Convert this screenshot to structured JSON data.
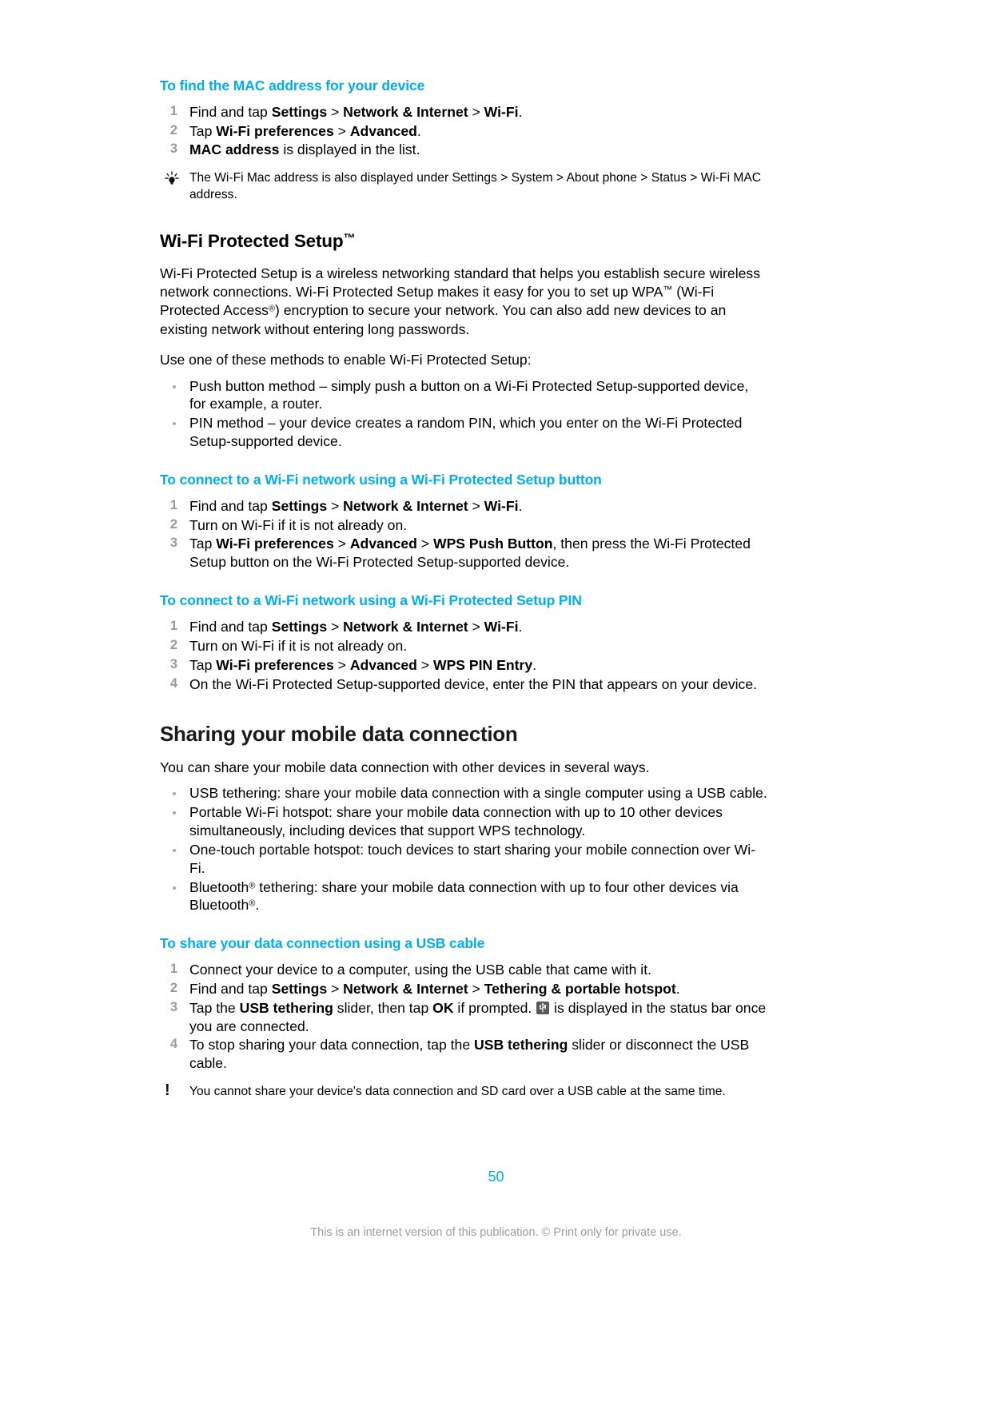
{
  "document": {
    "page_number": "50",
    "footer_note": "This is an internet version of this publication. © Print only for private use.",
    "accent_color": "#00AEEF",
    "step_number_color": "#9a9a9a"
  },
  "sections": {
    "mac_address": {
      "heading": "To find the MAC address for your device",
      "steps": [
        {
          "prefix": "Find and tap ",
          "b1": "Settings",
          "sep1": " > ",
          "b2": "Network & Internet",
          "sep2": " > ",
          "b3": "Wi-Fi",
          "suffix": "."
        },
        {
          "prefix": "Tap ",
          "b1": "Wi-Fi preferences",
          "sep1": " > ",
          "b2": "Advanced",
          "suffix": "."
        },
        {
          "b1": "MAC address",
          "suffix": " is displayed in the list."
        }
      ],
      "tip": {
        "icon": "lightbulb-icon",
        "text": "The Wi-Fi Mac address is also displayed under Settings > System > About phone > Status > Wi-Fi MAC address."
      }
    },
    "wps": {
      "heading": "Wi-Fi Protected Setup",
      "heading_tm": "™",
      "intro_p1_a": "Wi-Fi Protected Setup is a wireless networking standard that helps you establish secure wireless network connections. Wi-Fi Protected Setup makes it easy for you to set up WPA",
      "intro_p1_tm": "™",
      "intro_p1_b": " (Wi-Fi Protected Access",
      "intro_p1_reg": "®",
      "intro_p1_c": ") encryption to secure your network. You can also add new devices to an existing network without entering long passwords.",
      "intro_p2": "Use one of these methods to enable Wi-Fi Protected Setup:",
      "methods": [
        "Push button method – simply push a button on a Wi-Fi Protected Setup-supported device, for example, a router.",
        "PIN method – your device creates a random PIN, which you enter on the Wi-Fi Protected Setup-supported device."
      ],
      "button_proc": {
        "heading": "To connect to a Wi-Fi network using a Wi-Fi Protected Setup button",
        "steps": [
          {
            "prefix": "Find and tap ",
            "b1": "Settings",
            "sep1": " > ",
            "b2": "Network & Internet",
            "sep2": " > ",
            "b3": "Wi-Fi",
            "suffix": "."
          },
          {
            "prefix": "Turn on Wi-Fi if it is not already on."
          },
          {
            "prefix": "Tap ",
            "b1": "Wi-Fi preferences",
            "sep1": " > ",
            "b2": "Advanced",
            "sep2": " > ",
            "b3": "WPS Push Button",
            "suffix": ", then press the Wi-Fi Protected Setup button on the Wi-Fi Protected Setup-supported device."
          }
        ]
      },
      "pin_proc": {
        "heading": "To connect to a Wi-Fi network using a Wi-Fi Protected Setup PIN",
        "steps": [
          {
            "prefix": "Find and tap ",
            "b1": "Settings",
            "sep1": " > ",
            "b2": "Network & Internet",
            "sep2": " > ",
            "b3": "Wi-Fi",
            "suffix": "."
          },
          {
            "prefix": "Turn on Wi-Fi if it is not already on."
          },
          {
            "prefix": "Tap ",
            "b1": "Wi-Fi preferences",
            "sep1": " > ",
            "b2": "Advanced",
            "sep2": " > ",
            "b3": "WPS PIN Entry",
            "suffix": "."
          },
          {
            "prefix": "On the Wi-Fi Protected Setup-supported device, enter the PIN that appears on your device."
          }
        ]
      }
    },
    "sharing": {
      "heading": "Sharing your mobile data connection",
      "intro": "You can share your mobile data connection with other devices in several ways.",
      "methods": [
        {
          "text_a": "USB tethering: share your mobile data connection with a single computer using a USB cable."
        },
        {
          "text_a": "Portable Wi-Fi hotspot: share your mobile data connection with up to 10 other devices simultaneously, including devices that support WPS technology."
        },
        {
          "text_a": "One-touch portable hotspot: touch devices to start sharing your mobile connection over Wi-Fi."
        },
        {
          "text_a": "Bluetooth",
          "reg_a": "®",
          "text_b": " tethering: share your mobile data connection with up to four other devices via Bluetooth",
          "reg_b": "®",
          "text_c": "."
        }
      ],
      "usb_proc": {
        "heading": "To share your data connection using a USB cable",
        "step1": "Connect your device to a computer, using the USB cable that came with it.",
        "step2": {
          "prefix": "Find and tap ",
          "b1": "Settings",
          "sep1": " > ",
          "b2": "Network & Internet",
          "sep2": " > ",
          "b3": "Tethering & portable hotspot",
          "suffix": "."
        },
        "step3": {
          "prefix": "Tap the ",
          "b1": "USB tethering",
          "mid1": " slider, then tap ",
          "b2": "OK",
          "mid2": " if prompted. ",
          "icon": "usb-tethering-status-icon",
          "suffix": " is displayed in the status bar once you are connected."
        },
        "step4": {
          "prefix": "To stop sharing your data connection, tap the ",
          "b1": "USB tethering",
          "suffix": " slider or disconnect the USB cable."
        }
      },
      "warning": {
        "icon": "exclamation-icon",
        "text": "You cannot share your device's data connection and SD card over a USB cable at the same time."
      }
    }
  }
}
